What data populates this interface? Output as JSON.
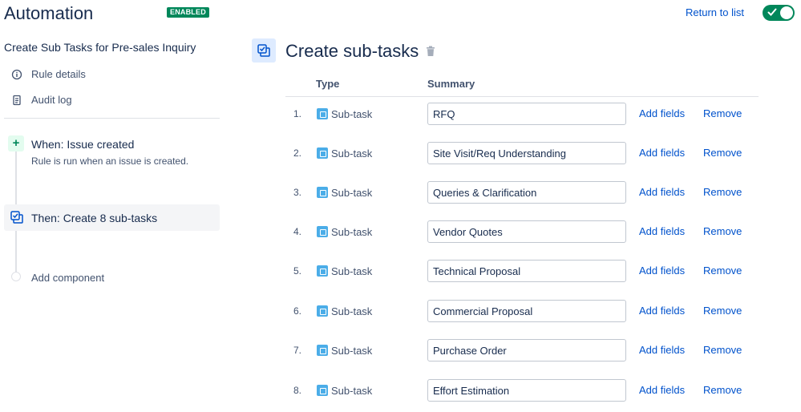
{
  "header": {
    "title": "Automation",
    "status_badge": "ENABLED",
    "return_link": "Return to list",
    "enabled_toggle": true
  },
  "sidebar": {
    "rule_name": "Create Sub Tasks for Pre-sales Inquiry",
    "links": [
      {
        "label": "Rule details",
        "icon": "info-icon"
      },
      {
        "label": "Audit log",
        "icon": "document-icon"
      }
    ],
    "trigger": {
      "title": "When: Issue created",
      "description": "Rule is run when an issue is created.",
      "icon": "plus-icon"
    },
    "action": {
      "title": "Then: Create 8 sub-tasks",
      "icon": "subtasks-icon"
    },
    "add_component": "Add component"
  },
  "main": {
    "title": "Create sub-tasks",
    "columns": {
      "type": "Type",
      "summary": "Summary"
    },
    "rows": [
      {
        "num": "1.",
        "type": "Sub-task",
        "summary": "RFQ"
      },
      {
        "num": "2.",
        "type": "Sub-task",
        "summary": "Site Visit/Req Understanding"
      },
      {
        "num": "3.",
        "type": "Sub-task",
        "summary": "Queries & Clarification"
      },
      {
        "num": "4.",
        "type": "Sub-task",
        "summary": "Vendor Quotes"
      },
      {
        "num": "5.",
        "type": "Sub-task",
        "summary": "Technical Proposal"
      },
      {
        "num": "6.",
        "type": "Sub-task",
        "summary": "Commercial Proposal"
      },
      {
        "num": "7.",
        "type": "Sub-task",
        "summary": "Purchase Order"
      },
      {
        "num": "8.",
        "type": "Sub-task",
        "summary": "Effort Estimation"
      }
    ],
    "add_fields_label": "Add fields",
    "remove_label": "Remove"
  },
  "colors": {
    "accent": "#0052cc",
    "enabled": "#00875a",
    "subtask": "#4bade8"
  }
}
